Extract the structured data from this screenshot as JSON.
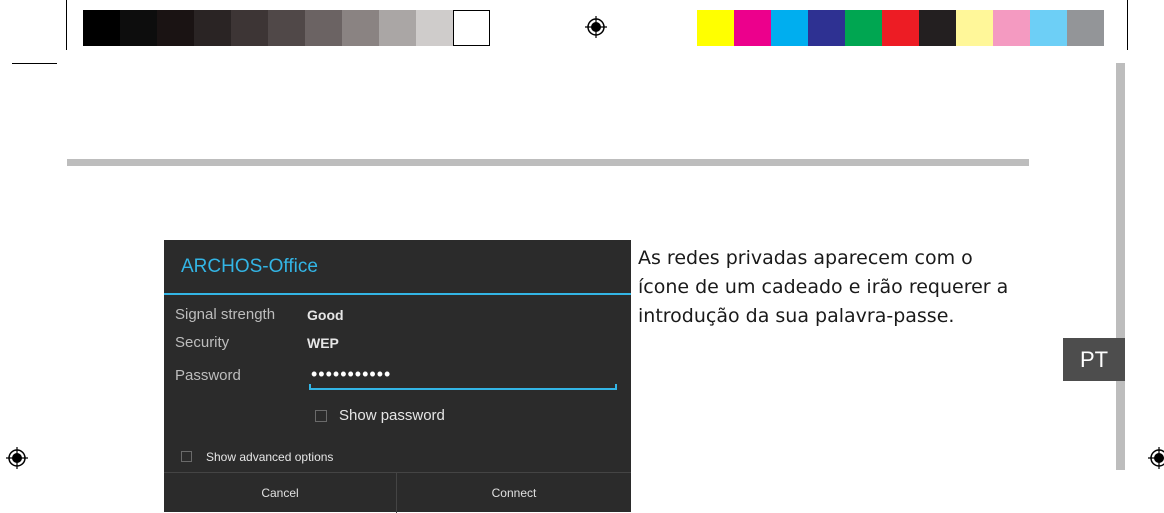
{
  "color_bar_left": [
    "#000000",
    "#0d0d0d",
    "#1a1313",
    "#2a2424",
    "#3d3535",
    "#504848",
    "#6b6363",
    "#8a8382",
    "#aaa6a5",
    "#cfcccb",
    "#ffffff"
  ],
  "color_bar_right": [
    "#ffff00",
    "#ec008c",
    "#00aeef",
    "#2e3192",
    "#00a651",
    "#ed1c24",
    "#231f20",
    "#fff799",
    "#f49ac1",
    "#6dcff6",
    "#939598"
  ],
  "dialog": {
    "title": "ARCHOS-Office",
    "signal_label": "Signal strength",
    "signal_value": "Good",
    "security_label": "Security",
    "security_value": "WEP",
    "password_label": "Password",
    "password_value": "•••••••••••",
    "show_password_label": "Show password",
    "advanced_label": "Show advanced options",
    "cancel_label": "Cancel",
    "connect_label": "Connect",
    "accent_color": "#33b5e5"
  },
  "body_text": "As redes privadas aparecem com o ícone de um cadeado e irão requerer a introdução da sua palavra-passe.",
  "language_tab": "PT"
}
